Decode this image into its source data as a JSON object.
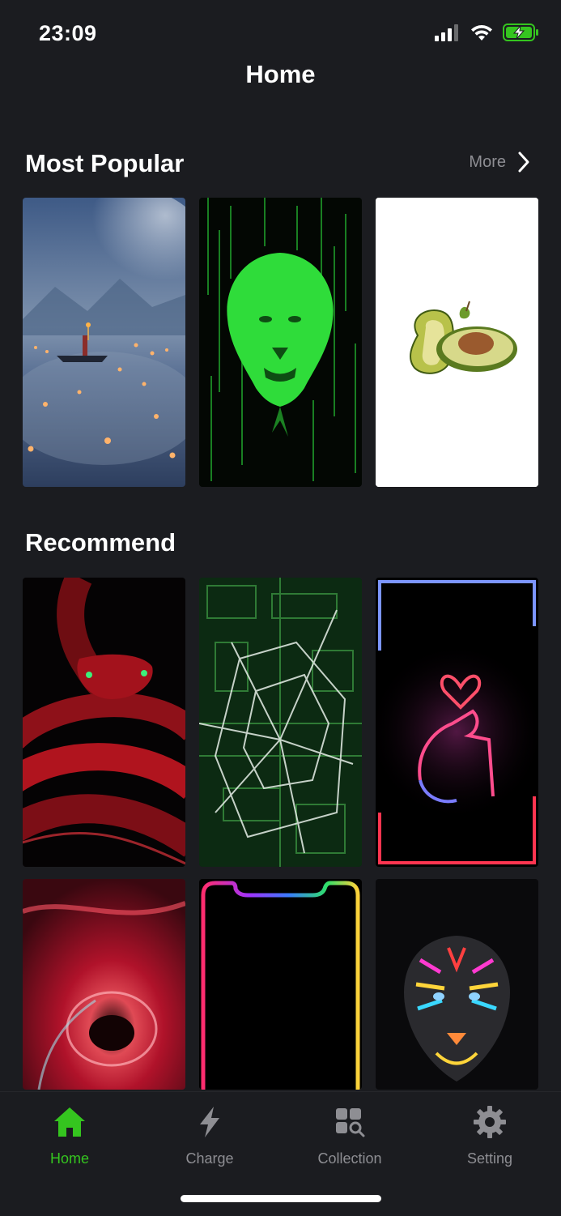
{
  "status_bar": {
    "time": "23:09"
  },
  "header": {
    "title": "Home"
  },
  "most_popular": {
    "title": "Most Popular",
    "more_label": "More",
    "items": [
      {
        "subject": "misty lake with boat and lanterns"
      },
      {
        "subject": "green neon matrix lion"
      },
      {
        "subject": "avocado halves on white"
      }
    ]
  },
  "recommend": {
    "title": "Recommend",
    "items": [
      {
        "subject": "red snake"
      },
      {
        "subject": "broken glass over circuit board"
      },
      {
        "subject": "neon heart hand sign"
      },
      {
        "subject": "red abstract tunnel"
      },
      {
        "subject": "rainbow edge light frame"
      },
      {
        "subject": "neon tiger"
      }
    ]
  },
  "tab_bar": {
    "active_color": "#35c51f",
    "inactive_color": "#8e8e93",
    "tabs": [
      {
        "label": "Home",
        "icon": "house-icon",
        "active": true
      },
      {
        "label": "Charge",
        "icon": "lightning-bolt-icon",
        "active": false
      },
      {
        "label": "Collection",
        "icon": "collection-search-icon",
        "active": false
      },
      {
        "label": "Setting",
        "icon": "gear-icon",
        "active": false
      }
    ]
  }
}
